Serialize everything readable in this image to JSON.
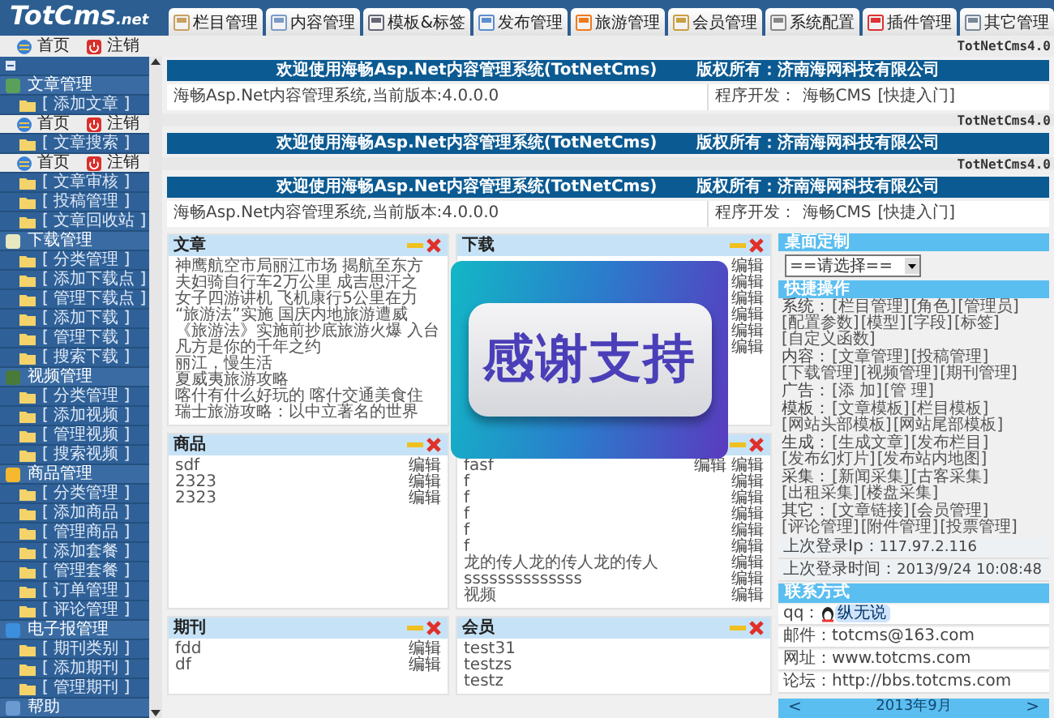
{
  "header": {
    "logo": "TotCms",
    "logo_suffix": ".net",
    "tabs": [
      {
        "label": "栏目管理",
        "selected": false
      },
      {
        "label": "内容管理",
        "selected": false
      },
      {
        "label": "模板&标签",
        "selected": false
      },
      {
        "label": "发布管理",
        "selected": false
      },
      {
        "label": "旅游管理",
        "selected": false
      },
      {
        "label": "会员管理",
        "selected": false
      },
      {
        "label": "系统配置",
        "selected": false
      },
      {
        "label": "插件管理",
        "selected": false
      },
      {
        "label": "其它管理",
        "selected": false
      }
    ]
  },
  "topbar": {
    "home": "首页",
    "logout": "注销",
    "version": "TotNetCms4.0"
  },
  "sidebar": {
    "groups": [
      {
        "label": "文章管理",
        "children": [
          {
            "kind": "link",
            "label": "[ 添加文章 ]"
          },
          {
            "kind": "toolbar",
            "home": "首页",
            "logout": "注销"
          },
          {
            "kind": "link",
            "label": "[ 文章搜索 ]"
          },
          {
            "kind": "toolbar",
            "home": "首页",
            "logout": "注销"
          },
          {
            "kind": "link",
            "label": "[ 文章审核 ]"
          },
          {
            "kind": "link",
            "label": "[ 投稿管理 ]"
          },
          {
            "kind": "link",
            "label": "[ 文章回收站 ]"
          }
        ]
      },
      {
        "label": "下载管理",
        "children": [
          {
            "kind": "link",
            "label": "[ 分类管理 ]"
          },
          {
            "kind": "link",
            "label": "[ 添加下载点 ]"
          },
          {
            "kind": "link",
            "label": "[ 管理下载点 ]"
          },
          {
            "kind": "link",
            "label": "[ 添加下载 ]"
          },
          {
            "kind": "link",
            "label": "[ 管理下载 ]"
          },
          {
            "kind": "link",
            "label": "[ 搜索下载 ]"
          }
        ]
      },
      {
        "label": "视频管理",
        "children": [
          {
            "kind": "link",
            "label": "[ 分类管理 ]"
          },
          {
            "kind": "link",
            "label": "[ 添加视频 ]"
          },
          {
            "kind": "link",
            "label": "[ 管理视频 ]"
          },
          {
            "kind": "link",
            "label": "[ 搜索视频 ]"
          }
        ]
      },
      {
        "label": "商品管理",
        "children": [
          {
            "kind": "link",
            "label": "[ 分类管理 ]"
          },
          {
            "kind": "link",
            "label": "[ 添加商品 ]"
          },
          {
            "kind": "link",
            "label": "[ 管理商品 ]"
          },
          {
            "kind": "link",
            "label": "[ 添加套餐 ]"
          },
          {
            "kind": "link",
            "label": "[ 管理套餐 ]"
          },
          {
            "kind": "link",
            "label": "[ 订单管理 ]"
          },
          {
            "kind": "link",
            "label": "[ 评论管理 ]"
          }
        ]
      },
      {
        "label": "电子报管理",
        "children": [
          {
            "kind": "link",
            "label": "[ 期刊类别 ]"
          },
          {
            "kind": "link",
            "label": "[ 添加期刊 ]"
          },
          {
            "kind": "link",
            "label": "[ 管理期刊 ]"
          }
        ]
      },
      {
        "label": "帮助"
      }
    ]
  },
  "main": {
    "blocks": [
      {
        "kind": "banner",
        "title": "欢迎使用海畅Asp.Net内容管理系统(TotNetCms)",
        "owner": "版权所有：济南海网科技有限公司"
      },
      {
        "kind": "info",
        "version": "海畅Asp.Net内容管理系统,当前版本:4.0.0.0",
        "dev_label": "程序开发：",
        "dev": "海畅CMS",
        "link": "[快捷入门]"
      },
      {
        "kind": "strip",
        "text": "TotNetCms4.0"
      },
      {
        "kind": "banner",
        "title": "欢迎使用海畅Asp.Net内容管理系统(TotNetCms)",
        "owner": "版权所有：济南海网科技有限公司"
      },
      {
        "kind": "strip",
        "text": "TotNetCms4.0"
      },
      {
        "kind": "banner",
        "title": "欢迎使用海畅Asp.Net内容管理系统(TotNetCms)",
        "owner": "版权所有：济南海网科技有限公司"
      },
      {
        "kind": "info",
        "version": "海畅Asp.Net内容管理系统,当前版本:4.0.0.0",
        "dev_label": "程序开发：",
        "dev": "海畅CMS",
        "link": "[快捷入门]"
      }
    ]
  },
  "panels": [
    {
      "title": "文章",
      "items": [
        {
          "text": "神鹰航空市局丽江市场 揭航至东方"
        },
        {
          "text": "夫妇骑自行车2万公里 成吉思汗之"
        },
        {
          "text": "女子四游讲机 飞机康行5公里在力"
        },
        {
          "text": "“旅游法”实施 国庆内地旅游遭威"
        },
        {
          "text": "《旅游法》实施前抄底旅游火爆 入台"
        },
        {
          "text": "凡方是你的千年之约"
        },
        {
          "text": "丽江，慢生活"
        },
        {
          "text": "夏威夷旅游攻略"
        },
        {
          "text": "喀什有什么好玩的 喀什交通美食住"
        },
        {
          "text": "瑞士旅游攻略：以中立著名的世界"
        }
      ]
    },
    {
      "title": "下载",
      "items": [
        {
          "actions": [
            "编辑"
          ]
        },
        {
          "actions": [
            "编辑"
          ]
        },
        {
          "actions": [
            "编辑"
          ]
        },
        {
          "actions": [
            "编辑"
          ]
        },
        {
          "actions": [
            "编辑"
          ]
        },
        {
          "actions": [
            "编辑"
          ]
        }
      ]
    },
    {
      "title": "商品",
      "items": [
        {
          "text": "sdf",
          "actions": [
            "编辑"
          ]
        },
        {
          "text": "2323",
          "actions": [
            "编辑"
          ]
        },
        {
          "text": "2323",
          "actions": [
            "编辑"
          ]
        }
      ]
    },
    {
      "items": [
        {
          "text": "fasf",
          "actions": [
            "编辑",
            "编辑"
          ]
        },
        {
          "text": "f",
          "actions": [
            "编辑"
          ]
        },
        {
          "text": "f",
          "actions": [
            "编辑"
          ]
        },
        {
          "text": "f",
          "actions": [
            "编辑"
          ]
        },
        {
          "text": "f",
          "actions": [
            "编辑"
          ]
        },
        {
          "text": "f",
          "actions": [
            "编辑"
          ]
        },
        {
          "text": "龙的传人龙的传人龙的传人",
          "actions": [
            "编辑"
          ]
        },
        {
          "text": "ssssssssssssss",
          "actions": [
            "编辑"
          ]
        },
        {
          "text": "视频",
          "actions": [
            "编辑"
          ]
        }
      ]
    },
    {
      "title": "期刊",
      "items": [
        {
          "text": "fdd",
          "actions": [
            "编辑"
          ]
        },
        {
          "text": "df",
          "actions": [
            "编辑"
          ]
        }
      ]
    },
    {
      "title": "会员",
      "items": [
        {
          "text": "test31"
        },
        {
          "text": "testzs"
        },
        {
          "text": "testz"
        }
      ]
    }
  ],
  "desktop": {
    "title": "桌面定制",
    "select": "==请选择=="
  },
  "quick": {
    "title": "快捷操作",
    "rows": [
      {
        "label": "系统：",
        "links": [
          "[栏目管理]",
          "[角色]",
          "[管理员]",
          "[配置参数]",
          "[模型]",
          "[字段]",
          "[标签]",
          "[自定义函数]"
        ]
      },
      {
        "label": "内容：",
        "links": [
          "[文章管理]",
          "[投稿管理]",
          "[下载管理]",
          "[视频管理]",
          "[期刊管理]"
        ]
      },
      {
        "label": "广告：",
        "links": [
          "[添 加]",
          "[管 理]"
        ]
      },
      {
        "label": "模板：",
        "links": [
          "[文章模板]",
          "[栏目模板]",
          "[网站头部模板]",
          "[网站尾部模板]"
        ]
      },
      {
        "label": "生成：",
        "links": [
          "[生成文章]",
          "[发布栏目]",
          "[发布幻灯片]",
          "[发布站内地图]"
        ]
      },
      {
        "label": "采集：",
        "links": [
          "[新闻采集]",
          "[古客采集]",
          "[出租采集]",
          "[楼盘采集]"
        ]
      },
      {
        "label": "其它：",
        "links": [
          "[文章链接]",
          "[会员管理]",
          "[评论管理]",
          "[附件管理]",
          "[投票管理]"
        ]
      }
    ]
  },
  "login": [
    {
      "label": "上次登录Ip：",
      "value": "117.97.2.116"
    },
    {
      "label": "上次登录时间：",
      "value": "2013/9/24 10:08:48"
    }
  ],
  "contact": {
    "title": "联系方式",
    "rows": [
      {
        "kind": "qq",
        "label": "qq：",
        "value": "纵无说"
      },
      {
        "kind": "text",
        "label": "邮件：",
        "value": "totcms@163.com"
      },
      {
        "kind": "text",
        "label": "网址：",
        "value": "www.totcms.com"
      },
      {
        "kind": "text",
        "label": "论坛：",
        "value": "http://bbs.totcms.com"
      }
    ]
  },
  "calendar": {
    "prev": "<",
    "month": "2013年9月",
    "next": ">"
  },
  "overlay": {
    "text": "感谢支持"
  }
}
